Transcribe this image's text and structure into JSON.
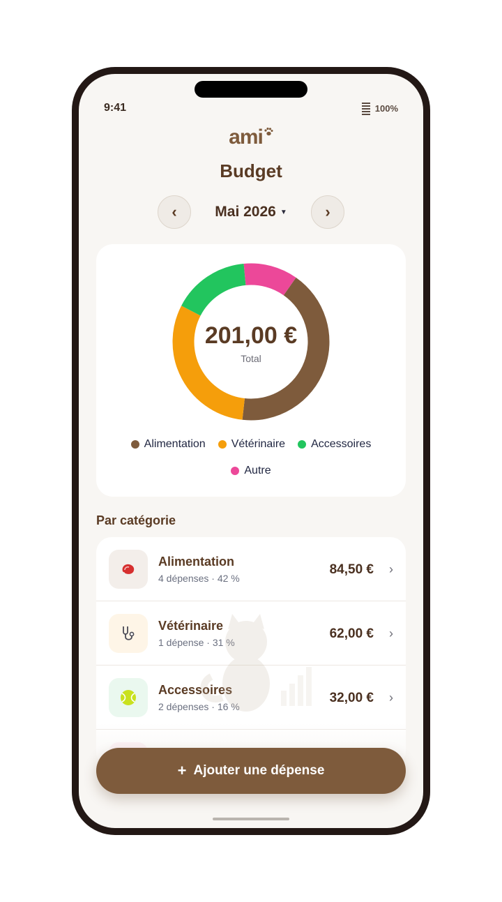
{
  "status": {
    "time": "9:41",
    "battery": "100%"
  },
  "logo": {
    "text": "ami"
  },
  "page": {
    "title": "Budget"
  },
  "month_nav": {
    "prev": "‹",
    "next": "›",
    "label": "Mai 2026",
    "caret": "▼"
  },
  "summary": {
    "total": "201,00 €",
    "total_label": "Total"
  },
  "legend": [
    {
      "label": "Alimentation",
      "color": "#7e5b3c"
    },
    {
      "label": "Vétérinaire",
      "color": "#f59e0b"
    },
    {
      "label": "Accessoires",
      "color": "#22c55e"
    },
    {
      "label": "Autre",
      "color": "#ec4899"
    }
  ],
  "section": {
    "title": "Par catégorie"
  },
  "categories": [
    {
      "name": "Alimentation",
      "sub": "4 dépenses · 42 %",
      "amount": "84,50 €",
      "icon": "meat-icon",
      "icon_bg": "#f3eeea"
    },
    {
      "name": "Vétérinaire",
      "sub": "1 dépense · 31 %",
      "amount": "62,00 €",
      "icon": "stethoscope-icon",
      "icon_bg": "#fef5e7"
    },
    {
      "name": "Accessoires",
      "sub": "2 dépenses · 16 %",
      "amount": "32,00 €",
      "icon": "tennis-ball-icon",
      "icon_bg": "#eaf8ef"
    }
  ],
  "chevron": "›",
  "add_button": {
    "plus": "+",
    "label": "Ajouter une dépense"
  },
  "chart_data": {
    "type": "pie",
    "center_text": "201,00 €",
    "center_label": "Total",
    "categories": [
      "Alimentation",
      "Vétérinaire",
      "Accessoires",
      "Autre"
    ],
    "values": [
      84.5,
      62,
      32,
      22.5
    ],
    "colors": [
      "#7e5b3c",
      "#f59e0b",
      "#22c55e",
      "#ec4899"
    ]
  }
}
